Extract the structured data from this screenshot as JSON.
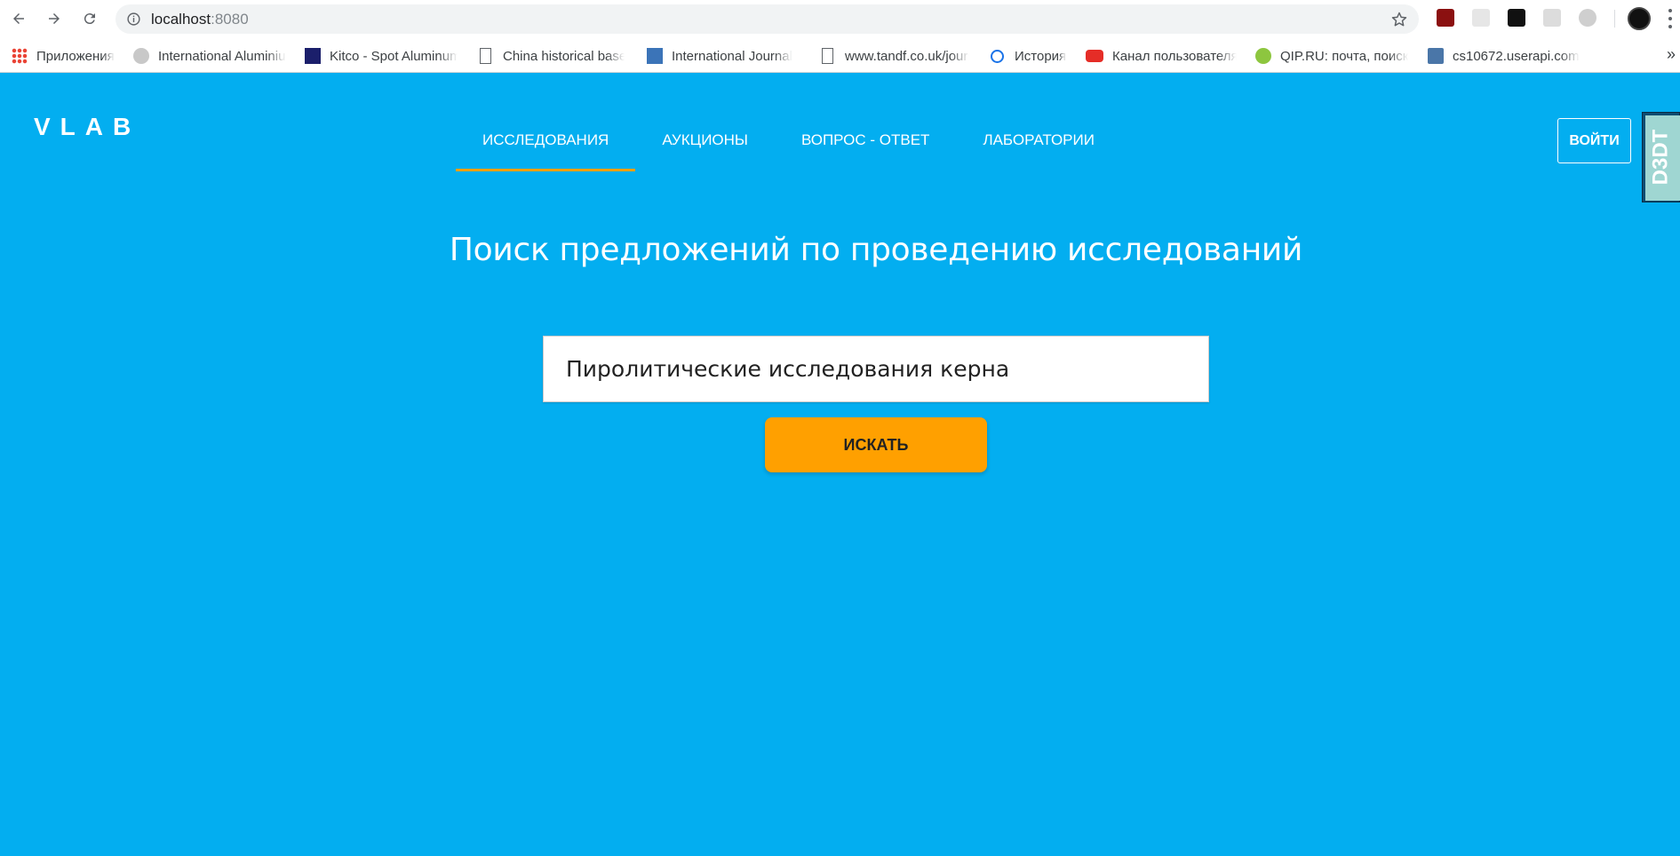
{
  "browser": {
    "url_host": "localhost",
    "url_port": ":8080",
    "bookmarks": [
      {
        "label": "Приложения",
        "icon": "apps-grid-icon"
      },
      {
        "label": "International Aluminium",
        "icon": "globe-icon"
      },
      {
        "label": "Kitco - Spot Aluminum",
        "icon": "kitco-icon"
      },
      {
        "label": "China historical base",
        "icon": "page-icon"
      },
      {
        "label": "International Journal",
        "icon": "journal-icon"
      },
      {
        "label": "www.tandf.co.uk/journals",
        "icon": "page-icon"
      },
      {
        "label": "История",
        "icon": "history-icon"
      },
      {
        "label": "Канал пользователя",
        "icon": "youtube-icon"
      },
      {
        "label": "QIP.RU: почта, поиск",
        "icon": "qip-icon"
      },
      {
        "label": "cs10672.userapi.com",
        "icon": "vk-icon"
      }
    ],
    "more_bookmarks": "»"
  },
  "site": {
    "logo": "VLAB",
    "nav": [
      {
        "label": "ИССЛЕДОВАНИЯ",
        "active": true
      },
      {
        "label": "АУКЦИОНЫ",
        "active": false
      },
      {
        "label": "ВОПРОС - ОТВЕТ",
        "active": false
      },
      {
        "label": "ЛАБОРАТОРИИ",
        "active": false
      }
    ],
    "login_label": "ВОЙТИ",
    "d3dt_label": "D3DT"
  },
  "search": {
    "heading": "Поиск предложений по проведению исследований",
    "value": "Пиролитические исследования керна",
    "button_label": "ИСКАТЬ"
  },
  "colors": {
    "background": "#03aef0",
    "accent": "#ffa000",
    "text_on_bg": "#ffffff"
  }
}
